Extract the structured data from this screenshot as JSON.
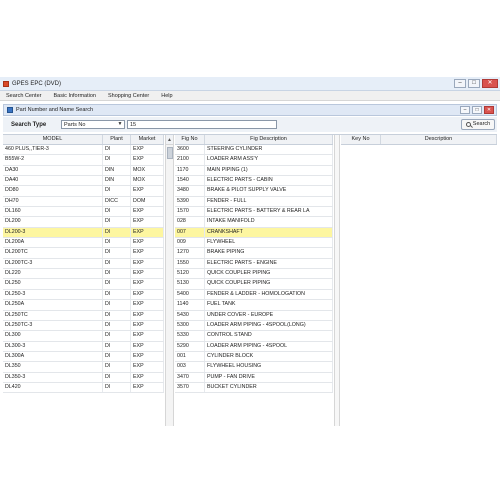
{
  "app": {
    "title": "GPES EPC (DVD)"
  },
  "window_controls": {
    "minimize": "–",
    "maximize": "□",
    "close": "✕"
  },
  "menu": [
    "Search Center",
    "Basic Information",
    "Shopping Center",
    "Help"
  ],
  "subwindow": {
    "title": "Part Number and Name Search"
  },
  "search": {
    "type_label": "Search Type",
    "type_value": "Parts No",
    "input_value": "15",
    "button_label": "Search"
  },
  "left_table": {
    "headers": [
      "MODEL",
      "Plant",
      "Market"
    ],
    "rows": [
      [
        "460 PLUS,,TIER-3",
        "DI",
        "EXP"
      ],
      [
        "B55W-2",
        "DI",
        "EXP"
      ],
      [
        "DA30",
        "DIN",
        "MOX"
      ],
      [
        "DA40",
        "DIN",
        "MOX"
      ],
      [
        "DD80",
        "DI",
        "EXP"
      ],
      [
        "DH70",
        "DICC",
        "DOM"
      ],
      [
        "DL160",
        "DI",
        "EXP"
      ],
      [
        "DL200",
        "DI",
        "EXP"
      ],
      [
        "DL200-3",
        "DI",
        "EXP"
      ],
      [
        "DL200A",
        "DI",
        "EXP"
      ],
      [
        "DL200TC",
        "DI",
        "EXP"
      ],
      [
        "DL200TC-3",
        "DI",
        "EXP"
      ],
      [
        "DL220",
        "DI",
        "EXP"
      ],
      [
        "DL250",
        "DI",
        "EXP"
      ],
      [
        "DL250-3",
        "DI",
        "EXP"
      ],
      [
        "DL250A",
        "DI",
        "EXP"
      ],
      [
        "DL250TC",
        "DI",
        "EXP"
      ],
      [
        "DL250TC-3",
        "DI",
        "EXP"
      ],
      [
        "DL300",
        "DI",
        "EXP"
      ],
      [
        "DL300-3",
        "DI",
        "EXP"
      ],
      [
        "DL300A",
        "DI",
        "EXP"
      ],
      [
        "DL350",
        "DI",
        "EXP"
      ],
      [
        "DL350-3",
        "DI",
        "EXP"
      ],
      [
        "DL420",
        "DI",
        "EXP"
      ]
    ],
    "highlight_row": 8
  },
  "mid_table": {
    "headers": [
      "Fig No",
      "Fig Description"
    ],
    "rows": [
      [
        "3600",
        "STEERING CYLINDER"
      ],
      [
        "2100",
        "LOADER ARM ASS'Y"
      ],
      [
        "1170",
        "MAIN PIPING (1)"
      ],
      [
        "1540",
        "ELECTRIC PARTS - CABIN"
      ],
      [
        "3480",
        "BRAKE & PILOT SUPPLY VALVE"
      ],
      [
        "5390",
        "FENDER - FULL"
      ],
      [
        "1570",
        "ELECTRIC PARTS - BATTERY & REAR LA"
      ],
      [
        "028",
        "INTAKE MANIFOLD"
      ],
      [
        "007",
        "CRANKSHAFT"
      ],
      [
        "009",
        "FLYWHEEL"
      ],
      [
        "1270",
        "BRAKE PIPING"
      ],
      [
        "1550",
        "ELECTRIC PARTS - ENGINE"
      ],
      [
        "5120",
        "QUICK COUPLER PIPING"
      ],
      [
        "5130",
        "QUICK COUPLER PIPING"
      ],
      [
        "5400",
        "FENDER & LADDER - HOMOLOGATION"
      ],
      [
        "1140",
        "FUEL TANK"
      ],
      [
        "5430",
        "UNDER COVER - EUROPE"
      ],
      [
        "5300",
        "LOADER ARM PIPING - 4SPOOL(LONG)"
      ],
      [
        "5330",
        "CONTROL STAND"
      ],
      [
        "5290",
        "LOADER ARM PIPING - 4SPOOL"
      ],
      [
        "001",
        "CYLINDER BLOCK"
      ],
      [
        "003",
        "FLYWHEEL HOUSING"
      ],
      [
        "3470",
        "PUMP - FAN DRIVE"
      ],
      [
        "3570",
        "BUCKET CYLINDER"
      ]
    ]
  },
  "right_table": {
    "headers": [
      "Key No",
      "Description"
    ]
  },
  "scroll": {
    "up_arrow": "▲"
  },
  "colors": {
    "highlight": "#fdf6a0",
    "titlebar": "#e6eef8"
  }
}
